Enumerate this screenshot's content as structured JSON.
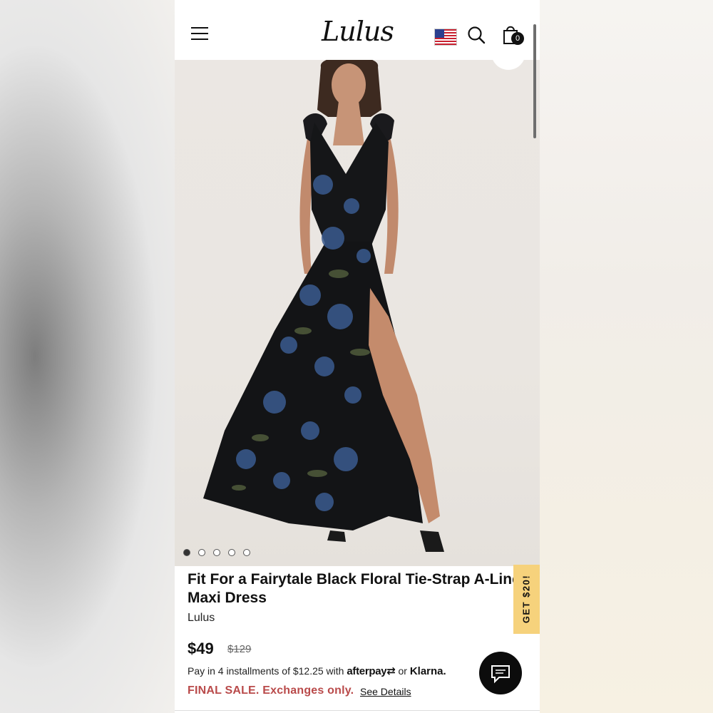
{
  "header": {
    "logo": "Lulus",
    "menu_icon": "hamburger-menu-icon",
    "flag_icon": "us-flag-icon",
    "search_icon": "search-icon",
    "bag_icon": "shopping-bag-icon",
    "bag_count": "0"
  },
  "gallery": {
    "image_count": 5,
    "active_index": 0
  },
  "product": {
    "title_line1": "Fit For a Fairytale Black Floral Tie-Strap A-Line",
    "title_line2": "Maxi Dress",
    "brand": "Lulus",
    "price": "$49",
    "original_price": "$129",
    "installments_text": "Pay in 4 installments of $12.25 with",
    "afterpay_label": "afterpay",
    "or_text": "or",
    "klarna_label": "Klarna.",
    "final_sale": "FINAL SALE. Exchanges only.",
    "see_details": "See Details"
  },
  "promo": {
    "label": "GET $20!"
  },
  "colors": {
    "accent_sale": "#b94a4a",
    "promo_bg": "#f6d27c",
    "chat_bg": "#0c0c0c"
  }
}
